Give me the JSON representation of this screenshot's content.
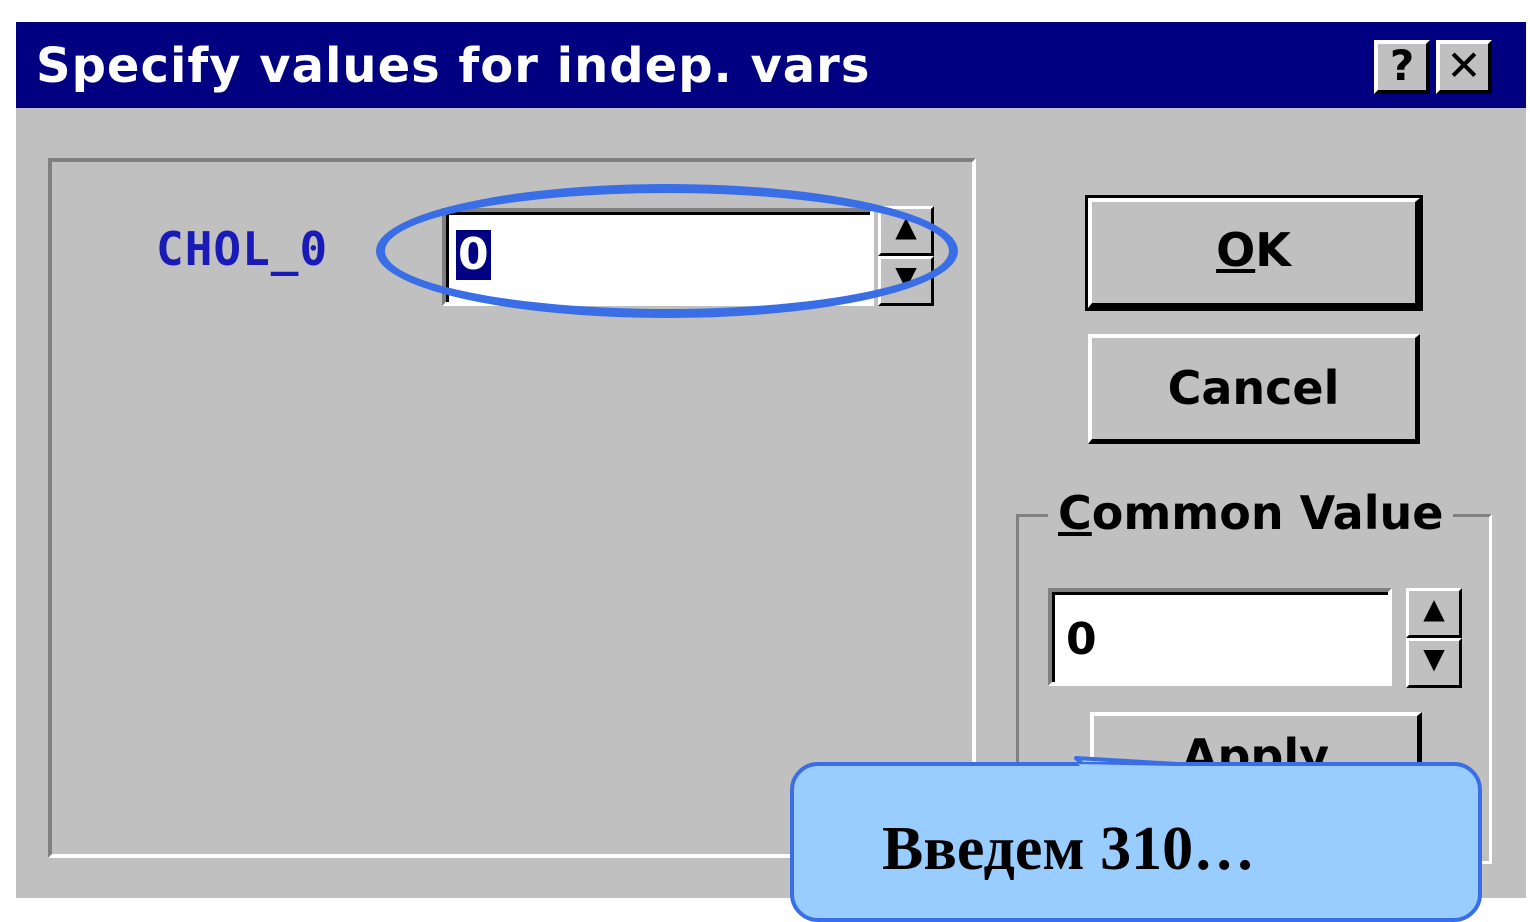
{
  "window": {
    "title": "Specify values for indep. vars",
    "help_label": "?",
    "close_label": "✕"
  },
  "variables": [
    {
      "name": "CHOL_0",
      "value": "0"
    }
  ],
  "buttons": {
    "ok_mnemonic": "O",
    "ok_rest": "K",
    "cancel": "Cancel",
    "apply": "Apply"
  },
  "common_value": {
    "label_mnemonic": "C",
    "label_rest": "ommon Value",
    "value": "0"
  },
  "annotation": {
    "callout_text": "Введем 310…",
    "highlight_color": "#3a6ee6",
    "callout_fill": "#99ccff"
  },
  "colors": {
    "titlebar": "#000080",
    "dialog_bg": "#c0c0c0",
    "label_blue": "#1a1ab8"
  }
}
